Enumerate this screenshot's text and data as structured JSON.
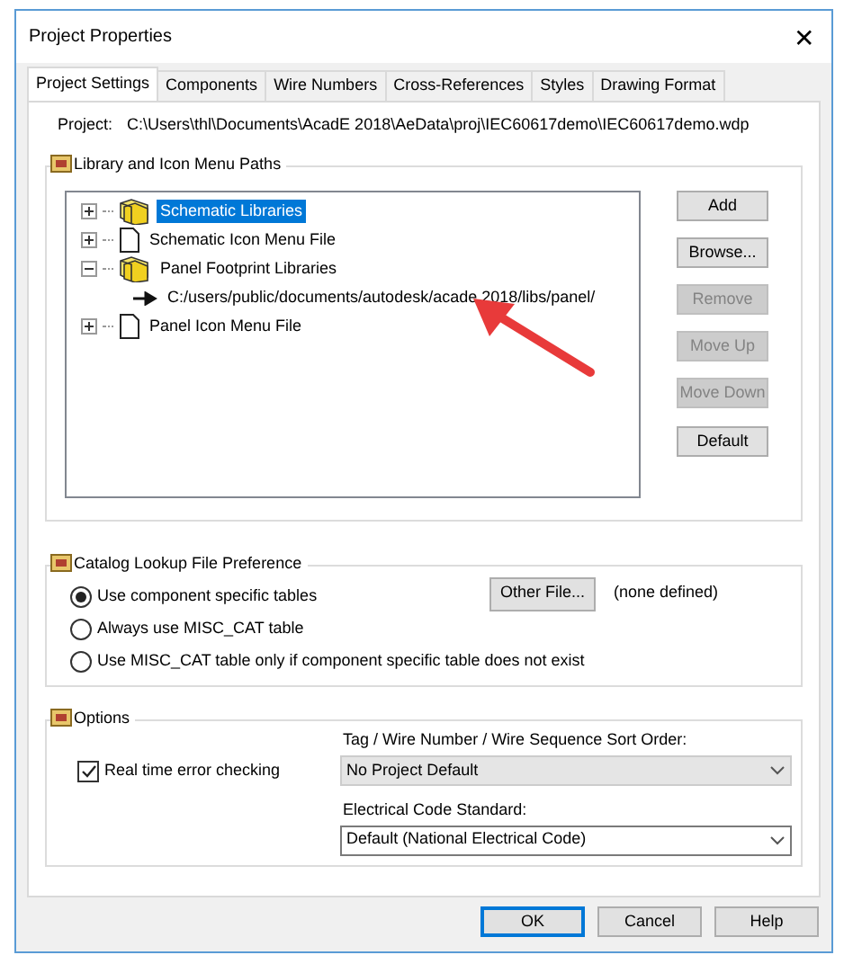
{
  "window": {
    "title": "Project Properties",
    "close": "✕"
  },
  "tabs": [
    {
      "label": "Project Settings",
      "selected": true
    },
    {
      "label": "Components",
      "selected": false
    },
    {
      "label": "Wire Numbers",
      "selected": false
    },
    {
      "label": "Cross-References",
      "selected": false
    },
    {
      "label": "Styles",
      "selected": false
    },
    {
      "label": "Drawing Format",
      "selected": false
    }
  ],
  "project": {
    "label": "Project:",
    "path": "C:\\Users\\thl\\Documents\\AcadE 2018\\AeData\\proj\\IEC60617demo\\IEC60617demo.wdp"
  },
  "library_group": {
    "title": "Library and Icon Menu Paths",
    "tree": [
      {
        "label": "Schematic Libraries",
        "kind": "library",
        "expanded": false,
        "selected": true
      },
      {
        "label": "Schematic Icon Menu File",
        "kind": "file",
        "expanded": false,
        "selected": false
      },
      {
        "label": "Panel Footprint Libraries",
        "kind": "library",
        "expanded": true,
        "selected": false,
        "children": [
          {
            "label": "C:/users/public/documents/autodesk/acade 2018/libs/panel/",
            "kind": "path",
            "selected": false
          }
        ]
      },
      {
        "label": "Panel Icon Menu File",
        "kind": "file",
        "expanded": false,
        "selected": false
      }
    ],
    "buttons": [
      {
        "label": "Add",
        "disabled": false
      },
      {
        "label": "Browse...",
        "disabled": false
      },
      {
        "label": "Remove",
        "disabled": true
      },
      {
        "label": "Move Up",
        "disabled": true
      },
      {
        "label": "Move Down",
        "disabled": true
      },
      {
        "label": "Default",
        "disabled": false
      }
    ]
  },
  "catalog_group": {
    "title": "Catalog Lookup File Preference",
    "options": [
      {
        "label": "Use component specific tables",
        "selected": true
      },
      {
        "label": "Always use MISC_CAT table",
        "selected": false
      },
      {
        "label": "Use MISC_CAT table only if component specific table does not exist",
        "selected": false
      }
    ],
    "other_file_button": "Other File...",
    "note": "(none defined)"
  },
  "options_group": {
    "title": "Options",
    "real_time_checking": {
      "label": "Real time error checking",
      "checked": true
    },
    "sort_order": {
      "label": "Tag / Wire Number / Wire Sequence Sort Order:",
      "value": "No Project Default",
      "disabled": true
    },
    "code_standard": {
      "label": "Electrical Code Standard:",
      "value": "Default (National Electrical Code)",
      "disabled": false
    }
  },
  "footer": [
    {
      "label": "OK",
      "default": true
    },
    {
      "label": "Cancel",
      "default": false
    },
    {
      "label": "Help",
      "default": false
    }
  ]
}
